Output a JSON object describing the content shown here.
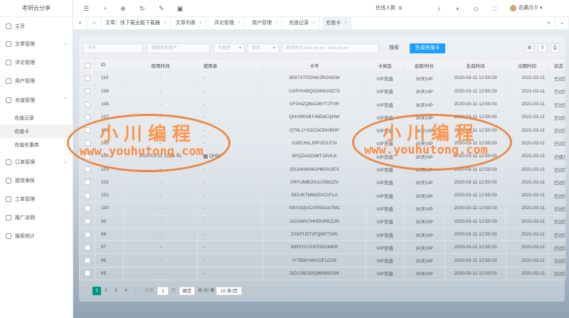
{
  "app": {
    "title": "考研云分享"
  },
  "sidebar": {
    "items": [
      {
        "label": "主页"
      },
      {
        "label": "文章管理"
      },
      {
        "label": "评论管理"
      },
      {
        "label": "用户管理"
      },
      {
        "label": "充值管理"
      },
      {
        "label": "订单管理"
      },
      {
        "label": "提现审核"
      },
      {
        "label": "工单管理"
      },
      {
        "label": "推广返佣"
      },
      {
        "label": "搜索统计"
      }
    ],
    "subitems": [
      {
        "label": "充值记录"
      },
      {
        "label": "充值卡"
      },
      {
        "label": "充值优惠券"
      }
    ]
  },
  "topbar": {
    "online_label": "在线人数",
    "online_count": "9",
    "user_name": "花藕月夕"
  },
  "tabs": [
    {
      "label": "文章：快下载全能下载器"
    },
    {
      "label": "文章列表"
    },
    {
      "label": "评论管理"
    },
    {
      "label": "用户管理"
    },
    {
      "label": "充值记录"
    },
    {
      "label": "充值卡"
    }
  ],
  "filters": {
    "card_no": "卡号",
    "user": "搜索使用用户",
    "card_type": "卡类型",
    "status": "状态",
    "time_range": "使用时间 xxxx-xx-xx - xxxx-xx-xx",
    "search_label": "搜索",
    "generate_label": "生成充值卡"
  },
  "table": {
    "headers": [
      "ID",
      "使用时间",
      "使用者",
      "卡号",
      "卡类型",
      "金额/时长",
      "生成时间",
      "过期时间",
      "状态"
    ],
    "rows": [
      {
        "id": "110",
        "used": "-",
        "user": "-",
        "card": "5E67XTPZNWJRGNGW",
        "type": "VIP充值",
        "amount": "30天VIP",
        "created": "2020-03-11 12:50:03",
        "expire": "2021-03-11",
        "status": "已过期"
      },
      {
        "id": "109",
        "used": "-",
        "user": "-",
        "card": "UXPYHWQ0O8W1NZ73",
        "type": "VIP充值",
        "amount": "30天VIP",
        "created": "2020-03-11 12:50:03",
        "expire": "2021-03-11",
        "status": "已过期"
      },
      {
        "id": "108",
        "used": "-",
        "user": "-",
        "card": "VFGNZQBAOBYTJTVR",
        "type": "VIP充值",
        "amount": "30天VIP",
        "created": "2020-03-11 12:50:03",
        "expire": "2021-03-11",
        "status": "已过期"
      },
      {
        "id": "107",
        "used": "-",
        "user": "-",
        "card": "QHV9RXBT46E8CQHW",
        "type": "VIP充值",
        "amount": "30天VIP",
        "created": "2020-03-11 12:50:03",
        "expire": "2021-03-11",
        "status": "已过期"
      },
      {
        "id": "106",
        "used": "-",
        "user": "-",
        "card": "QT9L1YS2CGODHBNP",
        "type": "VIP充值",
        "amount": "30天VIP",
        "created": "2020-03-11 12:50:03",
        "expire": "2021-03-11",
        "status": "已过期"
      },
      {
        "id": "105",
        "used": "-",
        "user": "-",
        "card": "GXEUHLJRP1EIUT3I",
        "type": "VIP充值",
        "amount": "30天VIP",
        "created": "2020-03-11 12:50:03",
        "expire": "2021-03-11",
        "status": "已过期"
      },
      {
        "id": "104",
        "used": "2020-03-11 12:51:41",
        "user": "QH94",
        "card": "4PQZAGDIMTJ3VILK",
        "type": "VIP充值",
        "amount": "30天VIP",
        "created": "2020-03-11 12:50:03",
        "expire": "2021-03-11",
        "status": "已使用"
      },
      {
        "id": "103",
        "used": "-",
        "user": "-",
        "card": "O0JAKMV6OHBUV2EX",
        "type": "VIP充值",
        "amount": "30天VIP",
        "created": "2020-03-11 12:50:03",
        "expire": "2021-03-11",
        "status": "已过期"
      },
      {
        "id": "102",
        "used": "-",
        "user": "-",
        "card": "XRYUMBJ0ULVS6OZV",
        "type": "VIP充值",
        "amount": "30天VIP",
        "created": "2020-03-11 12:50:03",
        "expire": "2021-03-11",
        "status": "已过期"
      },
      {
        "id": "101",
        "used": "-",
        "user": "-",
        "card": "I5DUKTMMJ0VC1FLA",
        "type": "VIP充值",
        "amount": "30天VIP",
        "created": "2020-03-11 12:50:03",
        "expire": "2021-03-11",
        "status": "已过期"
      },
      {
        "id": "100",
        "used": "-",
        "user": "-",
        "card": "SNYOQUCXP5GAA7M1",
        "type": "VIP充值",
        "amount": "30天VIP",
        "created": "2020-03-11 12:50:03",
        "expire": "2021-03-11",
        "status": "已过期"
      },
      {
        "id": "99",
        "used": "-",
        "user": "-",
        "card": "I1COWV7HHDURKZ2N",
        "type": "VIP充值",
        "amount": "30天VIP",
        "created": "2020-03-11 12:50:03",
        "expire": "2021-03-11",
        "status": "已过期"
      },
      {
        "id": "98",
        "used": "-",
        "user": "-",
        "card": "ZXKFU5T2FQW7TARI",
        "type": "VIP充值",
        "amount": "30天VIP",
        "created": "2020-03-11 12:50:03",
        "expire": "2021-03-11",
        "status": "已过期"
      },
      {
        "id": "97",
        "used": "-",
        "user": "-",
        "card": "WR0YVJY47I3G1MKR",
        "type": "VIP充值",
        "amount": "30天VIP",
        "created": "2020-03-11 12:50:03",
        "expire": "2021-03-11",
        "status": "已过期"
      },
      {
        "id": "96",
        "used": "-",
        "user": "-",
        "card": "IY7856YMV2JFLD1R",
        "type": "VIP充值",
        "amount": "30天VIP",
        "created": "2020-03-11 12:50:03",
        "expire": "2021-03-11",
        "status": "已过期"
      },
      {
        "id": "95",
        "used": "-",
        "user": "-",
        "card": "DCLCMJ32QIBN5GOW",
        "type": "VIP充值",
        "amount": "30天VIP",
        "created": "2020-03-11 12:50:03",
        "expire": "2021-03-11",
        "status": "已过期"
      }
    ]
  },
  "pager": {
    "pages": [
      "1",
      "2",
      "3",
      "4"
    ],
    "next": "›",
    "goto_label": "到第",
    "goto_value": "1",
    "page_unit": "页",
    "confirm": "确定",
    "total": "共 50 条",
    "per_page": "10 条/页"
  },
  "watermark": {
    "title": "小川编程",
    "url": "www.youhutong.com"
  }
}
